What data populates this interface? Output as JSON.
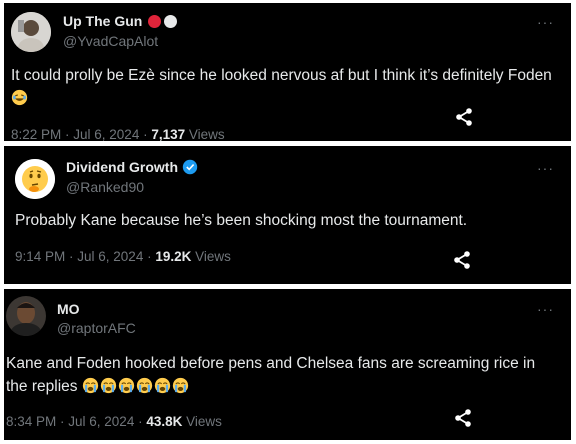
{
  "tweets": [
    {
      "name": "Up The Gun",
      "handle": "@YvadCapAlot",
      "text": "It could prolly be Ezè since he looked nervous af but I think it’s definitely Foden",
      "time": "8:22 PM · Jul 6, 2024",
      "views_count": "7,137",
      "views_label": "Views"
    },
    {
      "name": "Dividend Growth",
      "handle": "@Ranked90",
      "text": "Probably Kane because he’s been shocking most the tournament.",
      "time": "9:14 PM · Jul 6, 2024",
      "views_count": "19.2K",
      "views_label": "Views"
    },
    {
      "name": "MO",
      "handle": "@raptorAFC",
      "text": "Kane and Foden hooked before pens and Chelsea fans are screaming rice in the replies",
      "time": "8:34 PM · Jul 6, 2024",
      "views_count": "43.8K",
      "views_label": "Views"
    }
  ],
  "colors": {
    "card_bg": "#000000",
    "text_primary": "#e7e9ea",
    "text_secondary": "#71767b",
    "verified_blue": "#1d9bf0",
    "red_dot": "#e0243a"
  }
}
